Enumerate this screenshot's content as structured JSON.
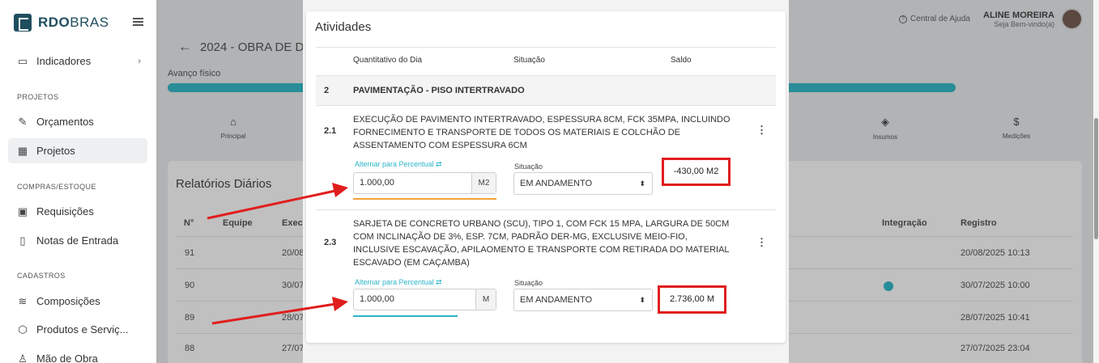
{
  "brand": {
    "name_bold": "RDO",
    "name_light": "BRAS"
  },
  "sidebar": {
    "indicadores": "Indicadores",
    "sections": {
      "projetos": "PROJETOS",
      "compras": "COMPRAS/ESTOQUE",
      "cadastros": "CADASTROS"
    },
    "items": {
      "orcamentos": "Orçamentos",
      "projetos": "Projetos",
      "requisicoes": "Requisições",
      "notas": "Notas de Entrada",
      "composicoes": "Composições",
      "produtos": "Produtos e Serviç...",
      "mao_obra": "Mão de Obra"
    }
  },
  "topbar": {
    "help": "Central de Ajuda",
    "user_name": "ALINE MOREIRA",
    "user_sub": "Seja Bem-vindo(a)"
  },
  "page": {
    "title": "2024 - OBRA DE D",
    "avanco": "Avanço físico"
  },
  "tabs": {
    "principal": "Principal",
    "insumos": "Insumos",
    "medicoes": "Medições"
  },
  "relatorios": {
    "title": "Relatórios Diários",
    "headers": {
      "n": "N°",
      "equipe": "Equipe",
      "execucao": "Execu",
      "integracao": "Integração",
      "registro": "Registro"
    },
    "rows": [
      {
        "n": "91",
        "exec": "20/08",
        "registro": "20/08/2025 10:13"
      },
      {
        "n": "90",
        "exec": "30/07",
        "registro": "30/07/2025 10:00"
      },
      {
        "n": "89",
        "exec": "28/07",
        "registro": "28/07/2025 10:41"
      },
      {
        "n": "88",
        "exec": "27/07",
        "registro": "27/07/2025 23:04"
      }
    ]
  },
  "modal": {
    "title": "Atividades",
    "headers": {
      "quantitativo": "Quantitativo do Dia",
      "situacao": "Situação",
      "saldo": "Saldo"
    },
    "section": {
      "num": "2",
      "name": "PAVIMENTAÇÃO - PISO INTERTRAVADO"
    },
    "activities": [
      {
        "num": "2.1",
        "description": "EXECUÇÃO DE PAVIMENTO INTERTRAVADO, ESPESSURA 8CM, FCK 35MPA, INCLUINDO FORNECIMENTO E TRANSPORTE DE TODOS OS MATERIAIS E COLCHÃO DE ASSENTAMENTO COM ESPESSURA 6CM",
        "alt_link": "Alternar para Percentual ⇄",
        "qty": "1.000,00",
        "unit": "M2",
        "situacao_label": "Situação",
        "situacao": "EM ANDAMENTO",
        "saldo": "-430,00 M2"
      },
      {
        "num": "2.3",
        "description": "SARJETA DE CONCRETO URBANO (SCU), TIPO 1, COM FCK 15 MPA, LARGURA DE 50CM COM INCLINAÇÃO DE 3%, ESP. 7CM, PADRÃO DER-MG, EXCLUSIVE MEIO-FIO, INCLUSIVE ESCAVAÇÃO, APILAOMENTO E TRANSPORTE COM RETIRADA DO MATERIAL ESCAVADO (EM CAÇAMBA)",
        "alt_link": "Alternar para Percentual ⇄",
        "qty": "1.000,00",
        "unit": "M",
        "situacao_label": "Situação",
        "situacao": "EM ANDAMENTO",
        "saldo": "2.736,00 M"
      }
    ]
  },
  "colors": {
    "accent": "#1fb4c3",
    "annotation": "#e01e1e",
    "warning_underline": "#f0a23a"
  }
}
